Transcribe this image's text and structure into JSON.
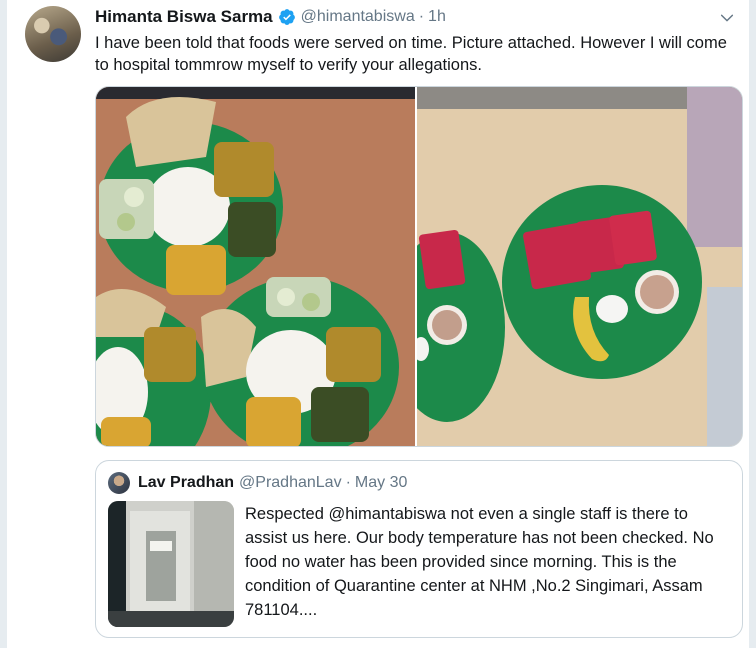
{
  "tweet": {
    "author_name": "Himanta Biswa Sarma",
    "handle": "@himantabiswa",
    "separator": "·",
    "time": "1h",
    "text": "I have been told that foods were served on time. Picture attached. However I will come to hospital tommrow myself to verify your allegations."
  },
  "media": {
    "photos": [
      "food-plates-photo",
      "breakfast-plates-photo"
    ]
  },
  "quote": {
    "author_name": "Lav Pradhan",
    "handle": "@PradhanLav",
    "separator": "·",
    "time": "May 30",
    "text": "Respected @himantabiswa not even a single staff is there to assist us here. Our body temperature has not been checked. No food no water has been provided since morning. This is the condition of Quarantine center at NHM ,No.2 Singimari, Assam 781104...."
  },
  "colors": {
    "background": "#e6ecf0",
    "text": "#14171a",
    "secondary_text": "#657786",
    "verified": "#1da1f2",
    "plate_green": "#1f8a4c"
  },
  "icons": [
    "verified-badge-icon",
    "chevron-down-icon"
  ]
}
